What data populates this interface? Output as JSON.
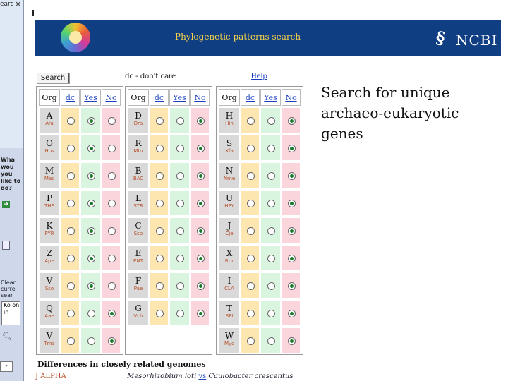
{
  "sidebar": {
    "title": "earc",
    "close": "×",
    "question": "Wha wou you like to do?",
    "clear_text": "Clear curre sear",
    "box_text": "Ko on in",
    "bottom_label": "-"
  },
  "banner": {
    "title": "Phylogenetic patterns search",
    "brand": "NCBI"
  },
  "toolbar": {
    "search_label": "Search",
    "dc_label": "dc - don't care",
    "help_label": "Help"
  },
  "table_headers": {
    "org": "Org",
    "dc": "dc",
    "yes": "Yes",
    "no": "No"
  },
  "panels": [
    [
      {
        "code": "A",
        "abbr": "Afu",
        "sel": "yes"
      },
      {
        "code": "O",
        "abbr": "Hbs",
        "sel": "yes"
      },
      {
        "code": "M",
        "abbr": "Mac",
        "sel": "yes"
      },
      {
        "code": "P",
        "abbr": "THE",
        "sel": "yes"
      },
      {
        "code": "K",
        "abbr": "PYR",
        "sel": "yes"
      },
      {
        "code": "Z",
        "abbr": "Ape",
        "sel": "yes"
      },
      {
        "code": "V",
        "abbr": "Sso",
        "sel": "yes"
      },
      {
        "code": "Q",
        "abbr": "Aae",
        "sel": "no"
      },
      {
        "code": "V",
        "abbr": "Tma",
        "sel": "no"
      }
    ],
    [
      {
        "code": "D",
        "abbr": "Dra",
        "sel": "no"
      },
      {
        "code": "R",
        "abbr": "Mtu",
        "sel": "no"
      },
      {
        "code": "B",
        "abbr": "BAC",
        "sel": "no"
      },
      {
        "code": "L",
        "abbr": "STR",
        "sel": "no"
      },
      {
        "code": "C",
        "abbr": "Ssp",
        "sel": "no"
      },
      {
        "code": "E",
        "abbr": "ENT",
        "sel": "no"
      },
      {
        "code": "F",
        "abbr": "Pae",
        "sel": "no"
      },
      {
        "code": "G",
        "abbr": "Vch",
        "sel": "no"
      }
    ],
    [
      {
        "code": "H",
        "abbr": "Hin",
        "sel": "no"
      },
      {
        "code": "S",
        "abbr": "Xfa",
        "sel": "no"
      },
      {
        "code": "N",
        "abbr": "Nme",
        "sel": "no"
      },
      {
        "code": "U",
        "abbr": "HPY",
        "sel": "no"
      },
      {
        "code": "J",
        "abbr": "Cje",
        "sel": "no"
      },
      {
        "code": "X",
        "abbr": "Rpr",
        "sel": "no"
      },
      {
        "code": "I",
        "abbr": "CLA",
        "sel": "no"
      },
      {
        "code": "T",
        "abbr": "SPI",
        "sel": "no"
      },
      {
        "code": "W",
        "abbr": "Myc",
        "sel": "no"
      }
    ]
  ],
  "side_text": "Search for unique archaeo-eukaryotic genes",
  "footer": {
    "diff_title": "Differences in closely related genomes",
    "code": "J ALPHA",
    "org1": "Mesorhizobium loti",
    "vs": "vs",
    "org2": "Caulobacter crescentus"
  }
}
